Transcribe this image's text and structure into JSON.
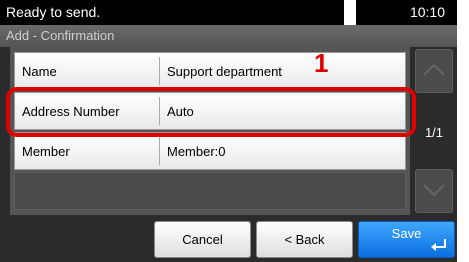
{
  "status": {
    "message": "Ready to send.",
    "time": "10:10"
  },
  "title": "Add - Confirmation",
  "rows": [
    {
      "label": "Name",
      "value": "Support department"
    },
    {
      "label": "Address Number",
      "value": "Auto"
    },
    {
      "label": "Member",
      "value": "Member:0"
    }
  ],
  "annotation": {
    "step": "1",
    "color": "#e00000"
  },
  "pager": {
    "indicator": "1/1"
  },
  "buttons": {
    "cancel": "Cancel",
    "back": "< Back",
    "save": "Save"
  },
  "icons": {
    "scroll_up": "chevron-up-icon",
    "scroll_down": "chevron-down-icon",
    "save_enter": "enter-return-icon"
  },
  "colors": {
    "accent": "#1a86f0",
    "highlight": "#e00000"
  }
}
